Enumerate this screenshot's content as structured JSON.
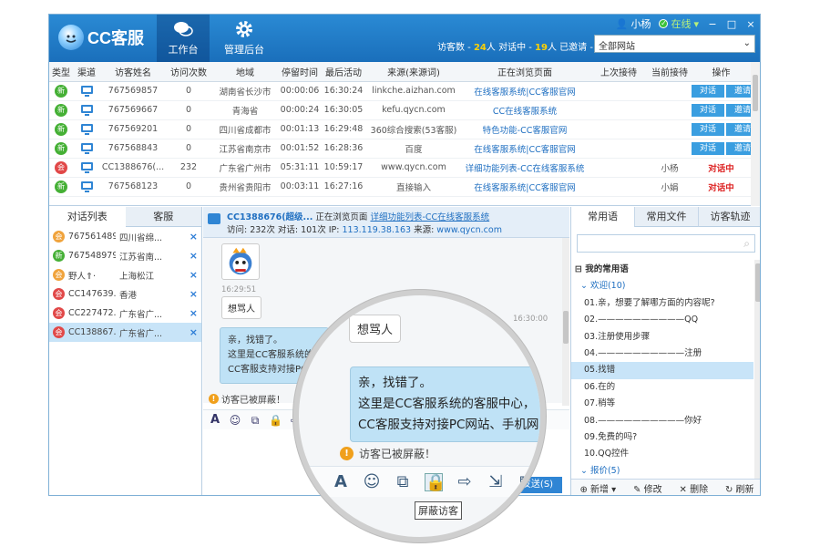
{
  "app": {
    "logo_text": "CC客服"
  },
  "nav": {
    "work": "工作台",
    "admin": "管理后台"
  },
  "titlebar": {
    "user": "小杨",
    "status": "在线",
    "min": "−",
    "max": "□",
    "close": "×"
  },
  "stats": {
    "visitors_label": "访客数 - ",
    "visitors": "24",
    "chatting_label": "人 对话中 - ",
    "chatting": "19",
    "invited_label": "人 已邀请 - ",
    "invited": "0",
    "unit": "人"
  },
  "site_select": {
    "value": "全部网站"
  },
  "table": {
    "headers": [
      "类型",
      "渠道",
      "访客姓名",
      "访问次数",
      "地域",
      "停留时间",
      "最后活动",
      "来源(来源词)",
      "正在浏览页面",
      "上次接待",
      "当前接待",
      "操作"
    ],
    "rows": [
      {
        "type": "新",
        "color": "g",
        "name": "767569857",
        "visits": "0",
        "region": "湖南省长沙市",
        "stay": "00:00:06",
        "last": "16:30:24",
        "source": "linkche.aizhan.com",
        "page": "在线客服系统|CC客服官网",
        "prev": "",
        "cur": "",
        "act1": "对话",
        "act2": "邀请"
      },
      {
        "type": "新",
        "color": "g",
        "name": "767569667",
        "visits": "0",
        "region": "青海省",
        "stay": "00:00:24",
        "last": "16:30:05",
        "source": "kefu.qycn.com",
        "page": "CC在线客服系统",
        "prev": "",
        "cur": "",
        "act1": "对话",
        "act2": "邀请"
      },
      {
        "type": "新",
        "color": "g",
        "name": "767569201",
        "visits": "0",
        "region": "四川省成都市",
        "stay": "00:01:13",
        "last": "16:29:48",
        "source": "360综合搜索(53客服)",
        "page": "特色功能-CC客服官网",
        "prev": "",
        "cur": "",
        "act1": "对话",
        "act2": "邀请"
      },
      {
        "type": "新",
        "color": "g",
        "name": "767568843",
        "visits": "0",
        "region": "江苏省南京市",
        "stay": "00:01:52",
        "last": "16:28:36",
        "source": "百度",
        "page": "在线客服系统|CC客服官网",
        "prev": "",
        "cur": "",
        "act1": "对话",
        "act2": "邀请"
      },
      {
        "type": "会",
        "color": "r",
        "name": "CC1388676(...",
        "visits": "232",
        "region": "广东省广州市",
        "stay": "05:31:11",
        "last": "10:59:17",
        "source": "www.qycn.com",
        "page": "详细功能列表-CC在线客服系统",
        "prev": "",
        "cur": "小杨",
        "act1": "对话中",
        "act2": ""
      },
      {
        "type": "新",
        "color": "g",
        "name": "767568123",
        "visits": "0",
        "region": "贵州省贵阳市",
        "stay": "00:03:11",
        "last": "16:27:16",
        "source": "直接输入",
        "page": "在线客服系统|CC客服官网",
        "prev": "",
        "cur": "小娟",
        "act1": "对话中",
        "act2": ""
      }
    ]
  },
  "left": {
    "tabs": [
      "对话列表",
      "客服"
    ],
    "items": [
      {
        "badge": "会",
        "color": "o",
        "id": "767561489",
        "loc": "四川省绵..."
      },
      {
        "badge": "新",
        "color": "g",
        "id": "767548979",
        "loc": "江苏省南..."
      },
      {
        "badge": "会",
        "color": "o",
        "id": "野人⇑·",
        "loc": "上海松江"
      },
      {
        "badge": "会",
        "color": "r",
        "id": "CC147639...",
        "loc": "香港"
      },
      {
        "badge": "会",
        "color": "r",
        "id": "CC227472...",
        "loc": "广东省广..."
      },
      {
        "badge": "会",
        "color": "r",
        "id": "CC138867...",
        "loc": "广东省广..."
      }
    ]
  },
  "chat": {
    "visitor": "CC1388676(超级...",
    "browsing_label": "正在浏览页面",
    "page_link": "详细功能列表-CC在线客服系统",
    "info": "访问: 232次 对话: 101次 IP: ",
    "ip": "113.119.38.163",
    "source_label": " 来源: ",
    "source": "www.qycn.com",
    "ts1": "16:29:51",
    "msg1": "想骂人",
    "ts2": "16:30:00",
    "msg2_l1": "亲，找错了。",
    "msg2_l2": "这里是CC客服系统的",
    "msg2_l3": "CC客服支持对接PC",
    "notice": "访客已被屏蔽！",
    "tooltip": "屏蔽",
    "send": "发送(S)",
    "record": "记录"
  },
  "magnifier": {
    "msg1": "想骂人",
    "ts": "16:30:00",
    "msg2_l1": "亲，找错了。",
    "msg2_l2": "这里是CC客服系统的客服中心，",
    "msg2_l3": "CC客服支持对接PC网站、手机网",
    "notice": "访客已被屏蔽！",
    "tooltip": "屏蔽访客",
    "send_fragment": "(S)"
  },
  "right": {
    "tabs": [
      "常用语",
      "常用文件",
      "访客轨迹"
    ],
    "tree": [
      {
        "t": "grp",
        "text": "我的常用语"
      },
      {
        "t": "sub",
        "text": "欢迎(10)"
      },
      {
        "t": "it",
        "text": "01.亲，想要了解哪方面的内容呢?"
      },
      {
        "t": "it",
        "text": "02.——————————QQ"
      },
      {
        "t": "it",
        "text": "03.注册使用步骤"
      },
      {
        "t": "it",
        "text": "04.——————————注册"
      },
      {
        "t": "it sel",
        "text": "05.找错"
      },
      {
        "t": "it",
        "text": "06.在的"
      },
      {
        "t": "it",
        "text": "07.稍等"
      },
      {
        "t": "it",
        "text": "08.——————————你好"
      },
      {
        "t": "it",
        "text": "09.免费的吗?"
      },
      {
        "t": "it",
        "text": "10.QQ控件"
      },
      {
        "t": "sub",
        "text": "报价(5)"
      }
    ],
    "footer": {
      "add": "新增",
      "edit": "修改",
      "delete": "删除",
      "refresh": "刷新"
    }
  },
  "colors": {
    "accent": "#1a6fbb",
    "green": "#45b035",
    "red": "#e14848",
    "orange": "#f0a33c"
  }
}
